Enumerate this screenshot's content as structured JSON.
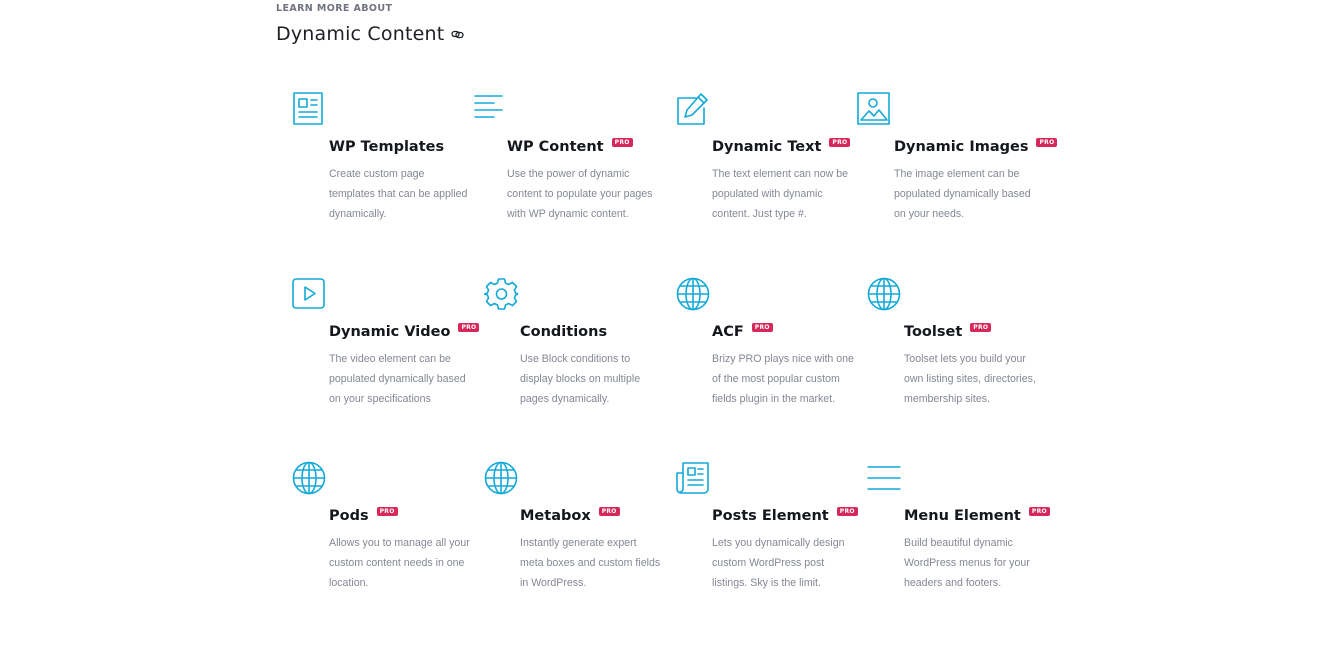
{
  "section": {
    "eyebrow": "LEARN MORE ABOUT",
    "title": "Dynamic Content",
    "title_icon": "link-icon"
  },
  "colors": {
    "accent": "#14a9d8",
    "pro_badge": "#d6285b",
    "title": "#14171c",
    "description": "#838893"
  },
  "features": [
    {
      "icon": "page-template-icon",
      "title": "WP Templates",
      "pro": "",
      "description": "Create custom page templates that can be applied dynamically."
    },
    {
      "icon": "text-lines-icon",
      "title": "WP Content",
      "pro": "PRO",
      "description": "Use the power of dynamic content to populate your pages with WP dynamic content."
    },
    {
      "icon": "pencil-edit-icon",
      "title": "Dynamic Text",
      "pro": "PRO",
      "description": "The text element can now be populated with dynamic content. Just type #."
    },
    {
      "icon": "image-icon",
      "title": "Dynamic Images",
      "pro": "PRO",
      "description": "The image element can be populated dynamically based on your needs."
    },
    {
      "icon": "play-video-icon",
      "title": "Dynamic Video",
      "pro": "PRO",
      "description": "The video element can be populated dynamically based on your specifications"
    },
    {
      "icon": "gear-icon",
      "title": "Conditions",
      "pro": "",
      "description": "Use Block conditions to display blocks on multiple pages dynamically."
    },
    {
      "icon": "globe-icon",
      "title": "ACF",
      "pro": "PRO",
      "description": "Brizy PRO plays nice with one of the most popular custom fields plugin in the market."
    },
    {
      "icon": "globe-icon",
      "title": "Toolset",
      "pro": "PRO",
      "description": "Toolset lets you build your own listing sites, directories, membership sites."
    },
    {
      "icon": "globe-icon",
      "title": "Pods",
      "pro": "PRO",
      "description": "Allows you to manage all your custom content needs in one location."
    },
    {
      "icon": "globe-icon",
      "title": "Metabox",
      "pro": "PRO",
      "description": "Instantly generate expert meta boxes and custom fields in WordPress."
    },
    {
      "icon": "newspaper-icon",
      "title": "Posts Element",
      "pro": "PRO",
      "description": "Lets you dynamically design custom WordPress post listings. Sky is the limit."
    },
    {
      "icon": "menu-lines-icon",
      "title": "Menu Element",
      "pro": "PRO",
      "description": "Build beautiful dynamic WordPress menus for your headers and footers."
    }
  ]
}
